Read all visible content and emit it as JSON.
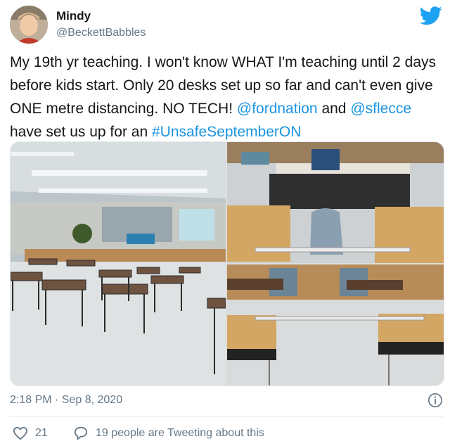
{
  "author": {
    "display_name": "Mindy",
    "handle": "@BeckettBabbles",
    "avatar_icon": "profile-photo"
  },
  "tweet": {
    "text_parts": [
      "My 19th yr teaching. I won't know WHAT I'm teaching until 2 days before kids start. Only 20 desks set up so far and can't even give ONE metre distancing. NO TECH! ",
      "@fordnation",
      " and ",
      "@sflecce",
      " have set us up for an ",
      "#UnsafeSeptemberON"
    ]
  },
  "media": {
    "photos": [
      "classroom-wide-view",
      "desks-with-rulers-top",
      "desks-with-rulers-bottom"
    ]
  },
  "meta": {
    "timestamp": "2:18 PM · Sep 8, 2020"
  },
  "stats": {
    "likes": "21",
    "replies_text": "19 people are Tweeting about this"
  },
  "colors": {
    "link": "#1b95e0",
    "text": "#14171a",
    "muted": "#657786",
    "twitter_blue": "#1da1f2"
  },
  "icons": [
    "twitter-bird-icon",
    "info-icon",
    "heart-icon",
    "reply-bubble-icon"
  ]
}
